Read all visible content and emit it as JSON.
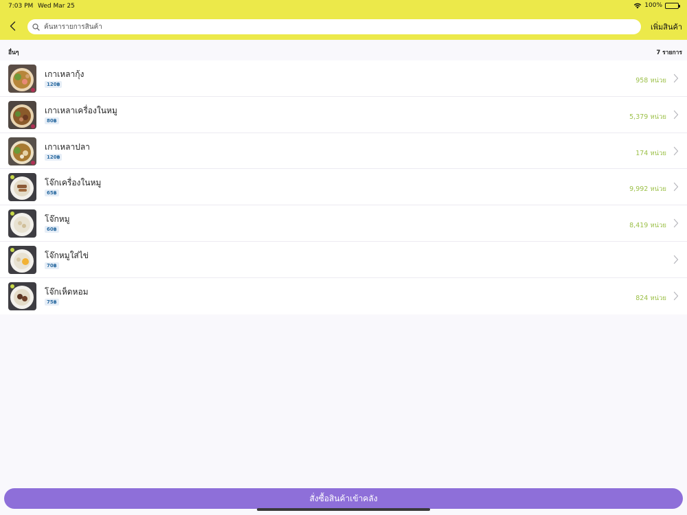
{
  "status_bar": {
    "time": "7:03 PM",
    "date": "Wed Mar 25",
    "battery": "100%"
  },
  "nav": {
    "search_placeholder": "ค้นหารายการสินค้า",
    "add_label": "เพิ่มสินค้า"
  },
  "section": {
    "title": "อื่นๆ",
    "count": "7 รายการ"
  },
  "products": [
    {
      "name": "เกาเหลากุ้ง",
      "price": "120฿",
      "qty": "958 หน่วย",
      "thumb": "noodle-soup"
    },
    {
      "name": "เกาเหลาเครื่องในหมู",
      "price": "80฿",
      "qty": "5,379 หน่วย",
      "thumb": "noodle-soup"
    },
    {
      "name": "เกาเหลาปลา",
      "price": "120฿",
      "qty": "174 หน่วย",
      "thumb": "noodle-soup"
    },
    {
      "name": "โจ๊กเครื่องในหมู",
      "price": "65฿",
      "qty": "9,992 หน่วย",
      "thumb": "congee"
    },
    {
      "name": "โจ๊กหมู",
      "price": "60฿",
      "qty": "8,419 หน่วย",
      "thumb": "congee"
    },
    {
      "name": "โจ๊กหมูใส่ไข่",
      "price": "70฿",
      "qty": "",
      "thumb": "congee-egg"
    },
    {
      "name": "โจ๊กเห็ดหอม",
      "price": "75฿",
      "qty": "824 หน่วย",
      "thumb": "congee-mushroom"
    }
  ],
  "footer": {
    "order_label": "สั่งซื้อสินค้าเข้าคลัง"
  },
  "colors": {
    "header_bg": "#ece94a",
    "accent": "#8e6fd9",
    "qty_text": "#9cc049",
    "price_badge_text": "#2a6aa0"
  }
}
